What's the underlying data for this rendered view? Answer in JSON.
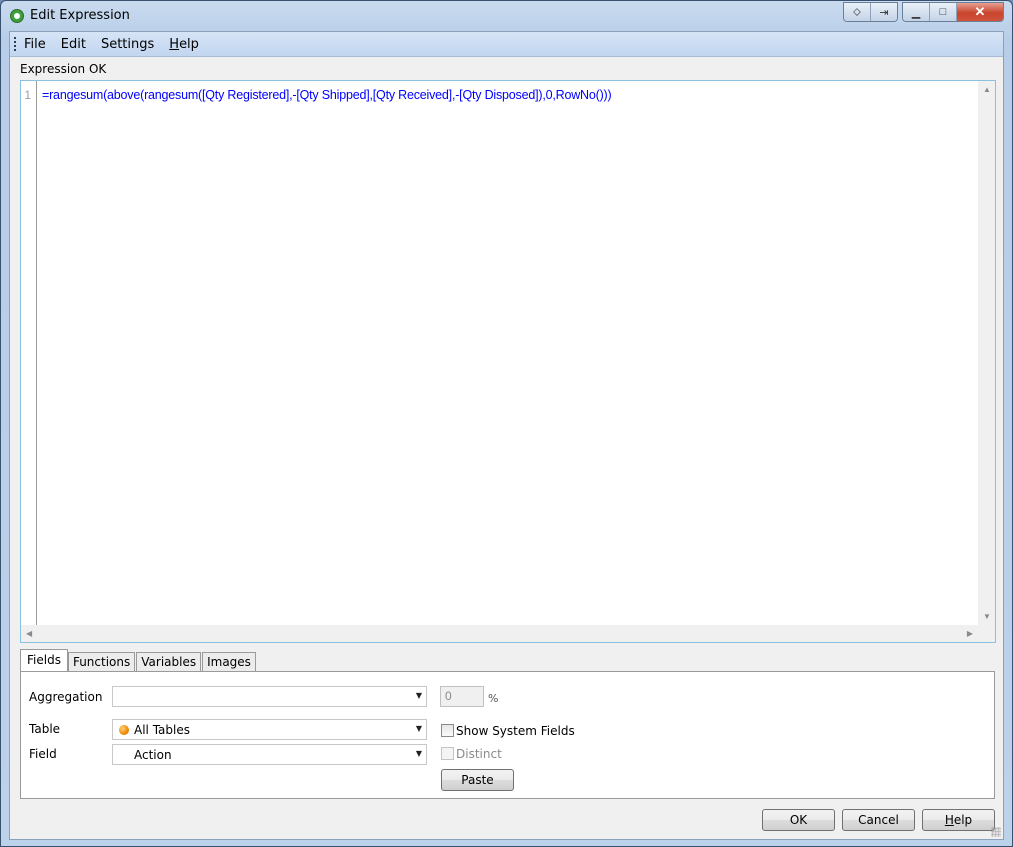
{
  "window": {
    "title": "Edit Expression",
    "caption_buttons": [
      "move-icon",
      "restore-to-tab-icon",
      "minimize-icon",
      "maximize-icon",
      "close-icon"
    ]
  },
  "menu": {
    "items": [
      {
        "label": "File"
      },
      {
        "label": "Edit"
      },
      {
        "label": "Settings"
      },
      {
        "label_pre": "",
        "label_u": "H",
        "label_post": "elp"
      }
    ]
  },
  "status": "Expression OK",
  "editor": {
    "line_number": "1",
    "code": "=rangesum(above(rangesum([Qty Registered],-[Qty Shipped],[Qty Received],-[Qty Disposed]),0,RowNo()))",
    "text_color": "#0000ff"
  },
  "tabs": [
    {
      "label": "Fields",
      "active": true
    },
    {
      "label": "Functions",
      "active": false
    },
    {
      "label": "Variables",
      "active": false
    },
    {
      "label": "Images",
      "active": false
    }
  ],
  "fields_panel": {
    "aggregation_label": "Aggregation",
    "aggregation_value": "",
    "percent_value": "0",
    "percent_suffix": "%",
    "table_label": "Table",
    "table_value": "All Tables",
    "show_system_fields_label": "Show System Fields",
    "show_system_fields_checked": false,
    "field_label": "Field",
    "field_value": "Action",
    "distinct_label": "Distinct",
    "distinct_checked": false,
    "distinct_enabled": false,
    "paste_label": "Paste"
  },
  "footer": {
    "ok_label": "OK",
    "cancel_label": "Cancel",
    "help_u": "H",
    "help_rest": "elp"
  }
}
